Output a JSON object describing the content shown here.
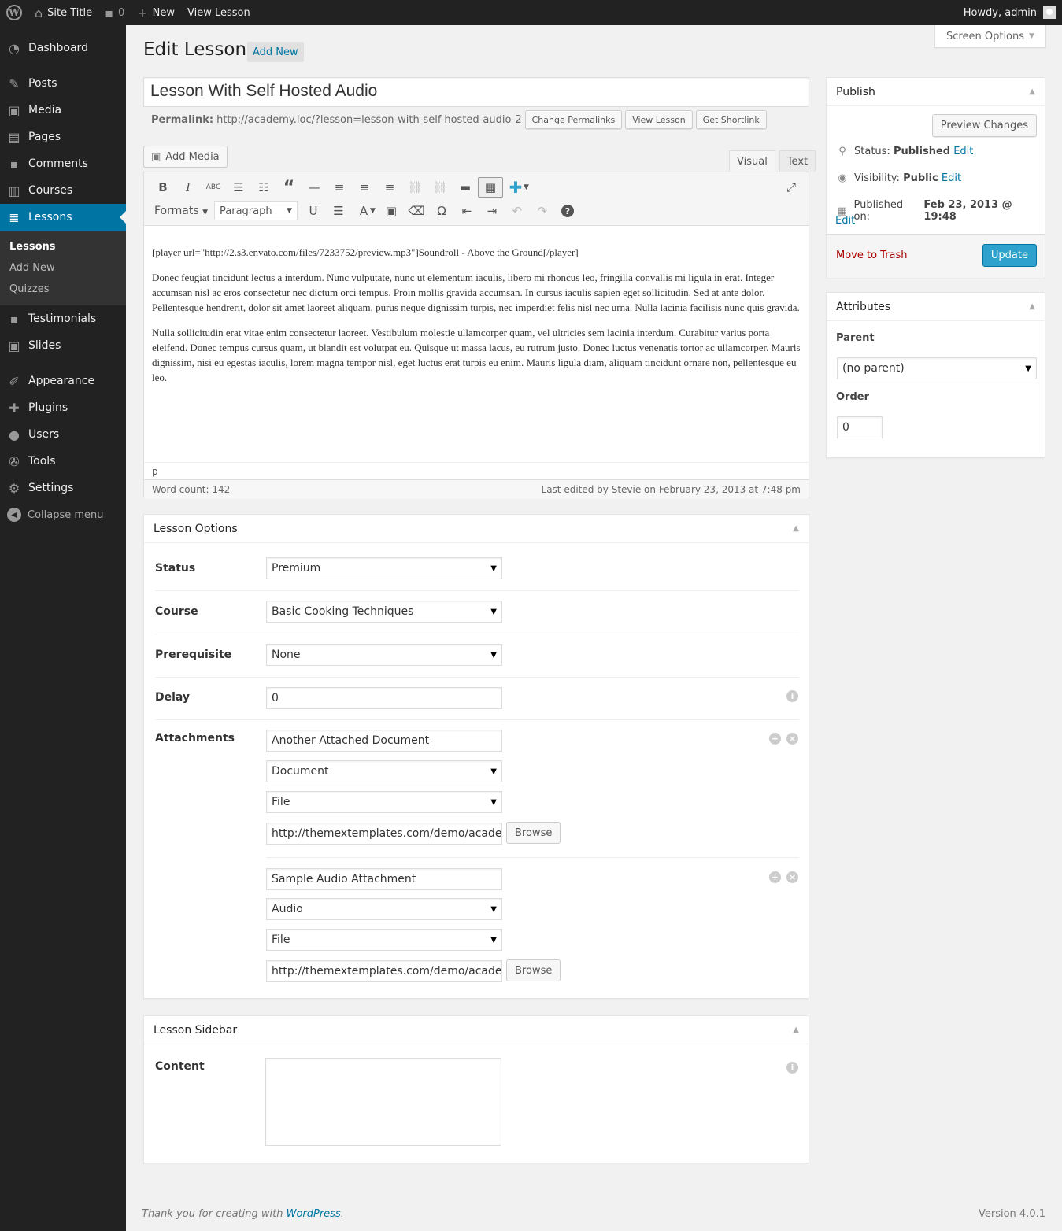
{
  "adminbar": {
    "site_title": "Site Title",
    "comments_count": "0",
    "new_label": "New",
    "view_label": "View Lesson",
    "howdy": "Howdy, admin"
  },
  "menu": {
    "items": [
      {
        "label": "Dashboard",
        "icon": "dashboard-icon"
      },
      {
        "label": "Posts",
        "icon": "pin-icon"
      },
      {
        "label": "Media",
        "icon": "media-icon"
      },
      {
        "label": "Pages",
        "icon": "pages-icon"
      },
      {
        "label": "Comments",
        "icon": "comment-icon"
      },
      {
        "label": "Courses",
        "icon": "courses-icon"
      },
      {
        "label": "Lessons",
        "icon": "lessons-icon"
      }
    ],
    "sub": [
      "Lessons",
      "Add New",
      "Quizzes"
    ],
    "items2": [
      {
        "label": "Testimonials"
      },
      {
        "label": "Slides"
      },
      {
        "label": "Appearance"
      },
      {
        "label": "Plugins"
      },
      {
        "label": "Users"
      },
      {
        "label": "Tools"
      },
      {
        "label": "Settings"
      }
    ],
    "collapse": "Collapse menu"
  },
  "screen_options": "Screen Options",
  "page": {
    "title": "Edit Lesson",
    "add_new": "Add New",
    "post_title": "Lesson With Self Hosted Audio"
  },
  "permalink": {
    "label": "Permalink:",
    "url": "http://academy.loc/?lesson=lesson-with-self-hosted-audio-2",
    "change": "Change Permalinks",
    "view": "View Lesson",
    "shortlink": "Get Shortlink"
  },
  "editor": {
    "add_media": "Add Media",
    "tab_visual": "Visual",
    "tab_text": "Text",
    "formats": "Formats",
    "paragraph": "Paragraph",
    "p1": "[player url=\"http://2.s3.envato.com/files/7233752/preview.mp3\"]Soundroll - Above the Ground[/player]",
    "p2": "Donec feugiat tincidunt lectus a interdum. Nunc vulputate, nunc ut elementum iaculis, libero mi rhoncus leo, fringilla convallis mi ligula in erat. Integer accumsan nisl ac eros consectetur nec dictum orci tempus. Proin mollis gravida accumsan. In cursus iaculis sapien eget sollicitudin. Sed at ante dolor. Pellentesque hendrerit, dolor sit amet laoreet aliquam, purus neque dignissim turpis, nec imperdiet felis nisl nec urna. Nulla lacinia facilisis nunc quis gravida.",
    "p3": "Nulla sollicitudin erat vitae enim consectetur laoreet. Vestibulum molestie ullamcorper quam, vel ultricies sem lacinia interdum. Curabitur varius porta eleifend. Donec tempus cursus quam, ut blandit est volutpat eu. Quisque ut massa lacus, eu rutrum justo. Donec luctus venenatis tortor ac ullamcorper. Mauris dignissim, nisi eu egestas iaculis, lorem magna tempor nisl, eget luctus erat turpis eu enim. Mauris ligula diam, aliquam tincidunt ornare non, pellentesque eu leo.",
    "path": "p",
    "word_count": "Word count: 142",
    "last_edited": "Last edited by Stevie on February 23, 2013 at 7:48 pm"
  },
  "publish": {
    "title": "Publish",
    "preview": "Preview Changes",
    "status_label": "Status:",
    "status": "Published",
    "visibility_label": "Visibility:",
    "visibility": "Public",
    "published_label": "Published on:",
    "published": "Feb 23, 2013 @ 19:48",
    "edit": "Edit",
    "trash": "Move to Trash",
    "update": "Update"
  },
  "attributes": {
    "title": "Attributes",
    "parent_label": "Parent",
    "parent": "(no parent)",
    "order_label": "Order",
    "order": "0"
  },
  "lesson_options": {
    "title": "Lesson Options",
    "status_label": "Status",
    "status": "Premium",
    "course_label": "Course",
    "course": "Basic Cooking Techniques",
    "prereq_label": "Prerequisite",
    "prereq": "None",
    "delay_label": "Delay",
    "delay": "0",
    "attachments_label": "Attachments",
    "attachments": [
      {
        "title": "Another Attached Document",
        "type": "Document",
        "source": "File",
        "url": "http://themextemplates.com/demo/academ"
      },
      {
        "title": "Sample Audio Attachment",
        "type": "Audio",
        "source": "File",
        "url": "http://themextemplates.com/demo/academ"
      }
    ],
    "browse": "Browse"
  },
  "lesson_sidebar": {
    "title": "Lesson Sidebar",
    "content_label": "Content"
  },
  "footer": {
    "thanks": "Thank you for creating with",
    "wp": "WordPress",
    "version": "Version 4.0.1"
  },
  "colors": {
    "accent": "#0074a2",
    "primary_button": "#2ea2cc",
    "admin_bar": "#222222",
    "trash": "#a00"
  }
}
